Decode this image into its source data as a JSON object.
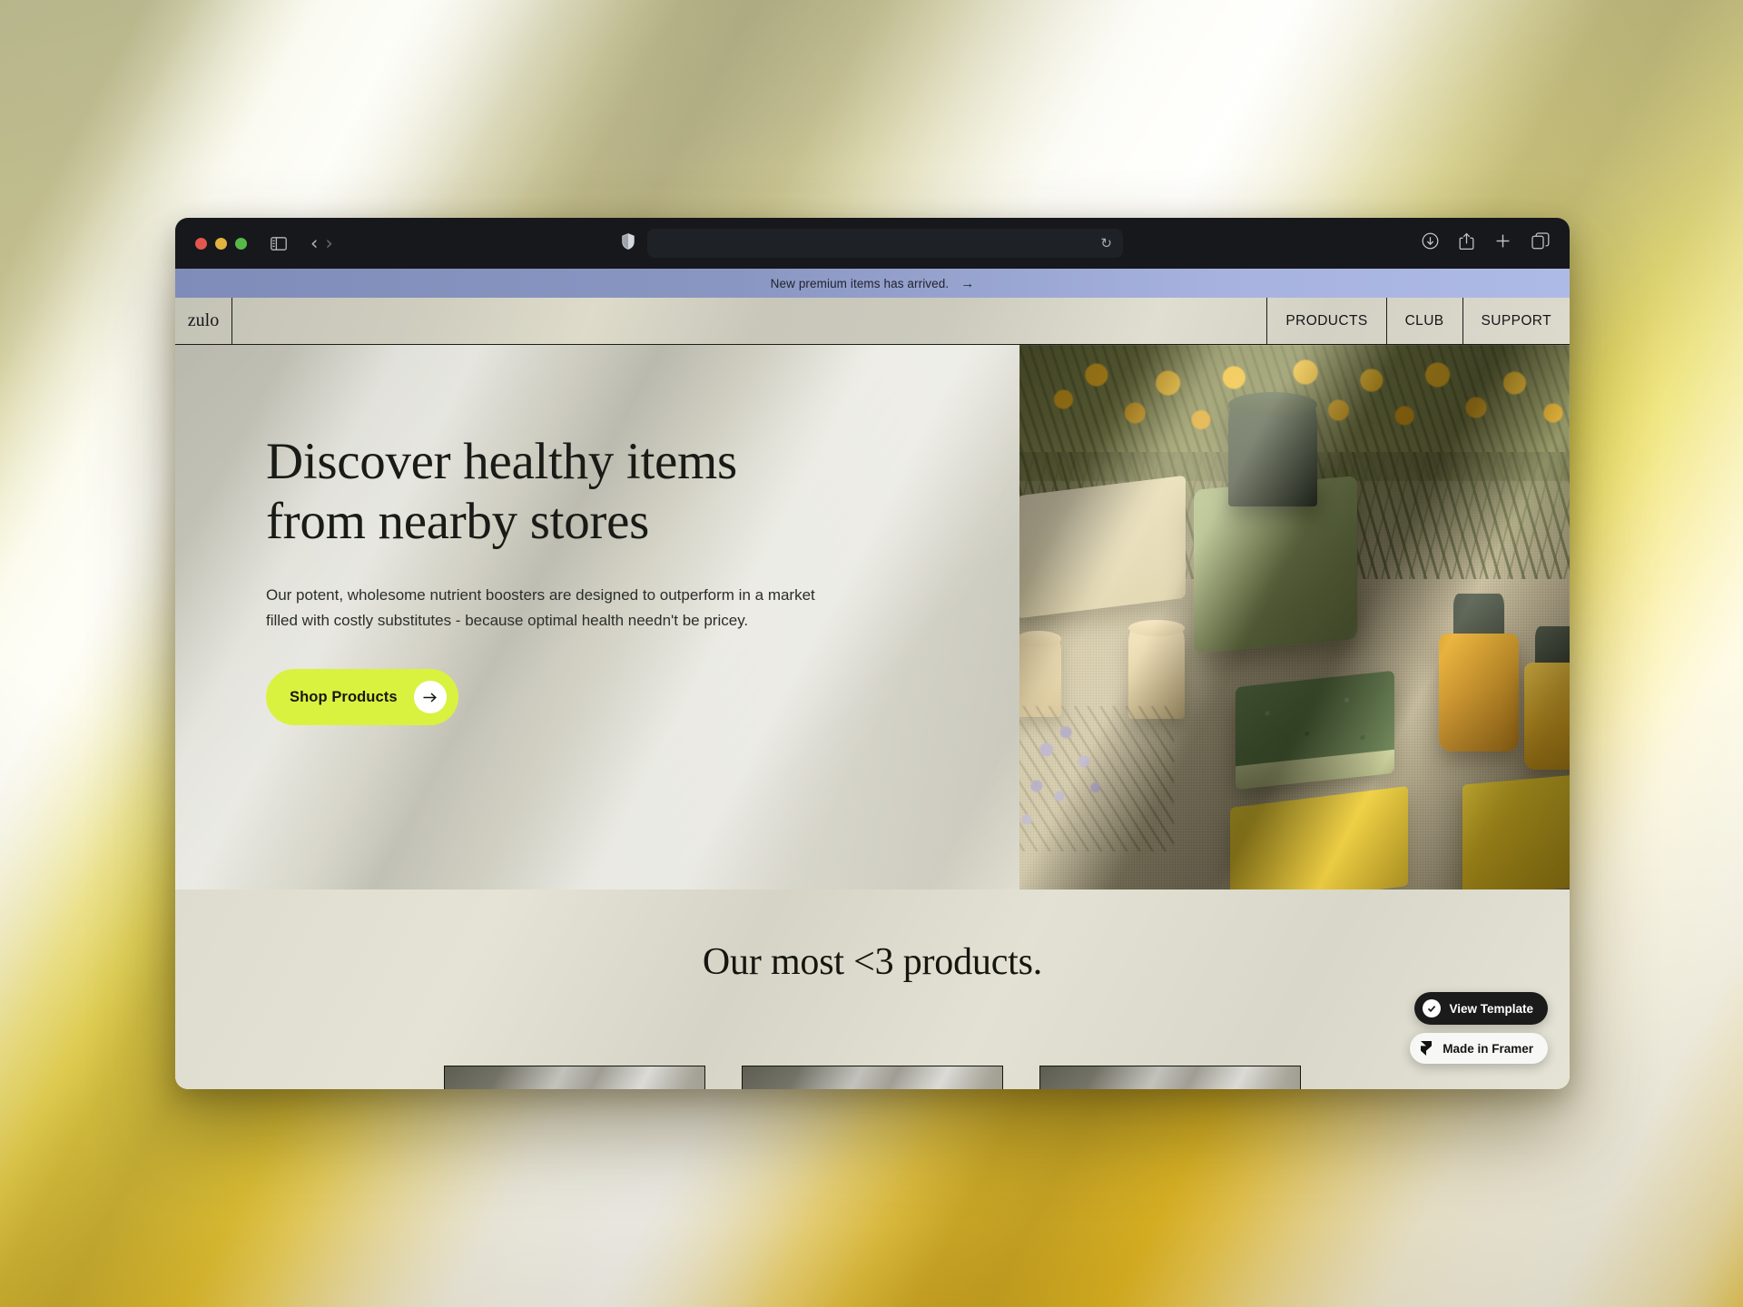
{
  "browser": {
    "window_controls": [
      "close",
      "minimize",
      "maximize"
    ],
    "sidebar_icon": "sidebar-icon",
    "back_icon": "‹",
    "forward_icon": "›",
    "shield_icon": "shield-icon",
    "address_value": "",
    "address_placeholder": "",
    "reload_icon": "↻",
    "right_icons": [
      "download-icon",
      "share-icon",
      "new-tab-icon",
      "tab-overview-icon"
    ]
  },
  "announcement": {
    "text": "New premium items has arrived.",
    "arrow": "→"
  },
  "site_nav": {
    "logo": "zulo",
    "items": [
      {
        "label": "PRODUCTS"
      },
      {
        "label": "CLUB"
      },
      {
        "label": "SUPPORT"
      }
    ]
  },
  "hero": {
    "heading": "Discover healthy items from nearby stores",
    "body": "Our potent, wholesome nutrient boosters are designed to outperform in a market filled with costly substitutes - because optimal health needn't be pricey.",
    "cta_label": "Shop Products",
    "cta_arrow": "→",
    "cta_color": "#d9f23f",
    "image_alt": "product blocks, amber bottles, dried flowers on linen"
  },
  "products_section": {
    "title": "Our most <3 products.",
    "cards": [
      {
        "name": "product-card-1"
      },
      {
        "name": "product-card-2"
      },
      {
        "name": "product-card-3"
      }
    ]
  },
  "badges": {
    "view_template": "View Template",
    "made_in_framer": "Made in Framer"
  },
  "colors": {
    "accent_lime": "#d9f23f",
    "announce_bar": "#8a96c2",
    "page_bg": "#d7d6c8",
    "chrome_bg": "#16181c",
    "desktop_yellow": "#f2cd2c"
  }
}
